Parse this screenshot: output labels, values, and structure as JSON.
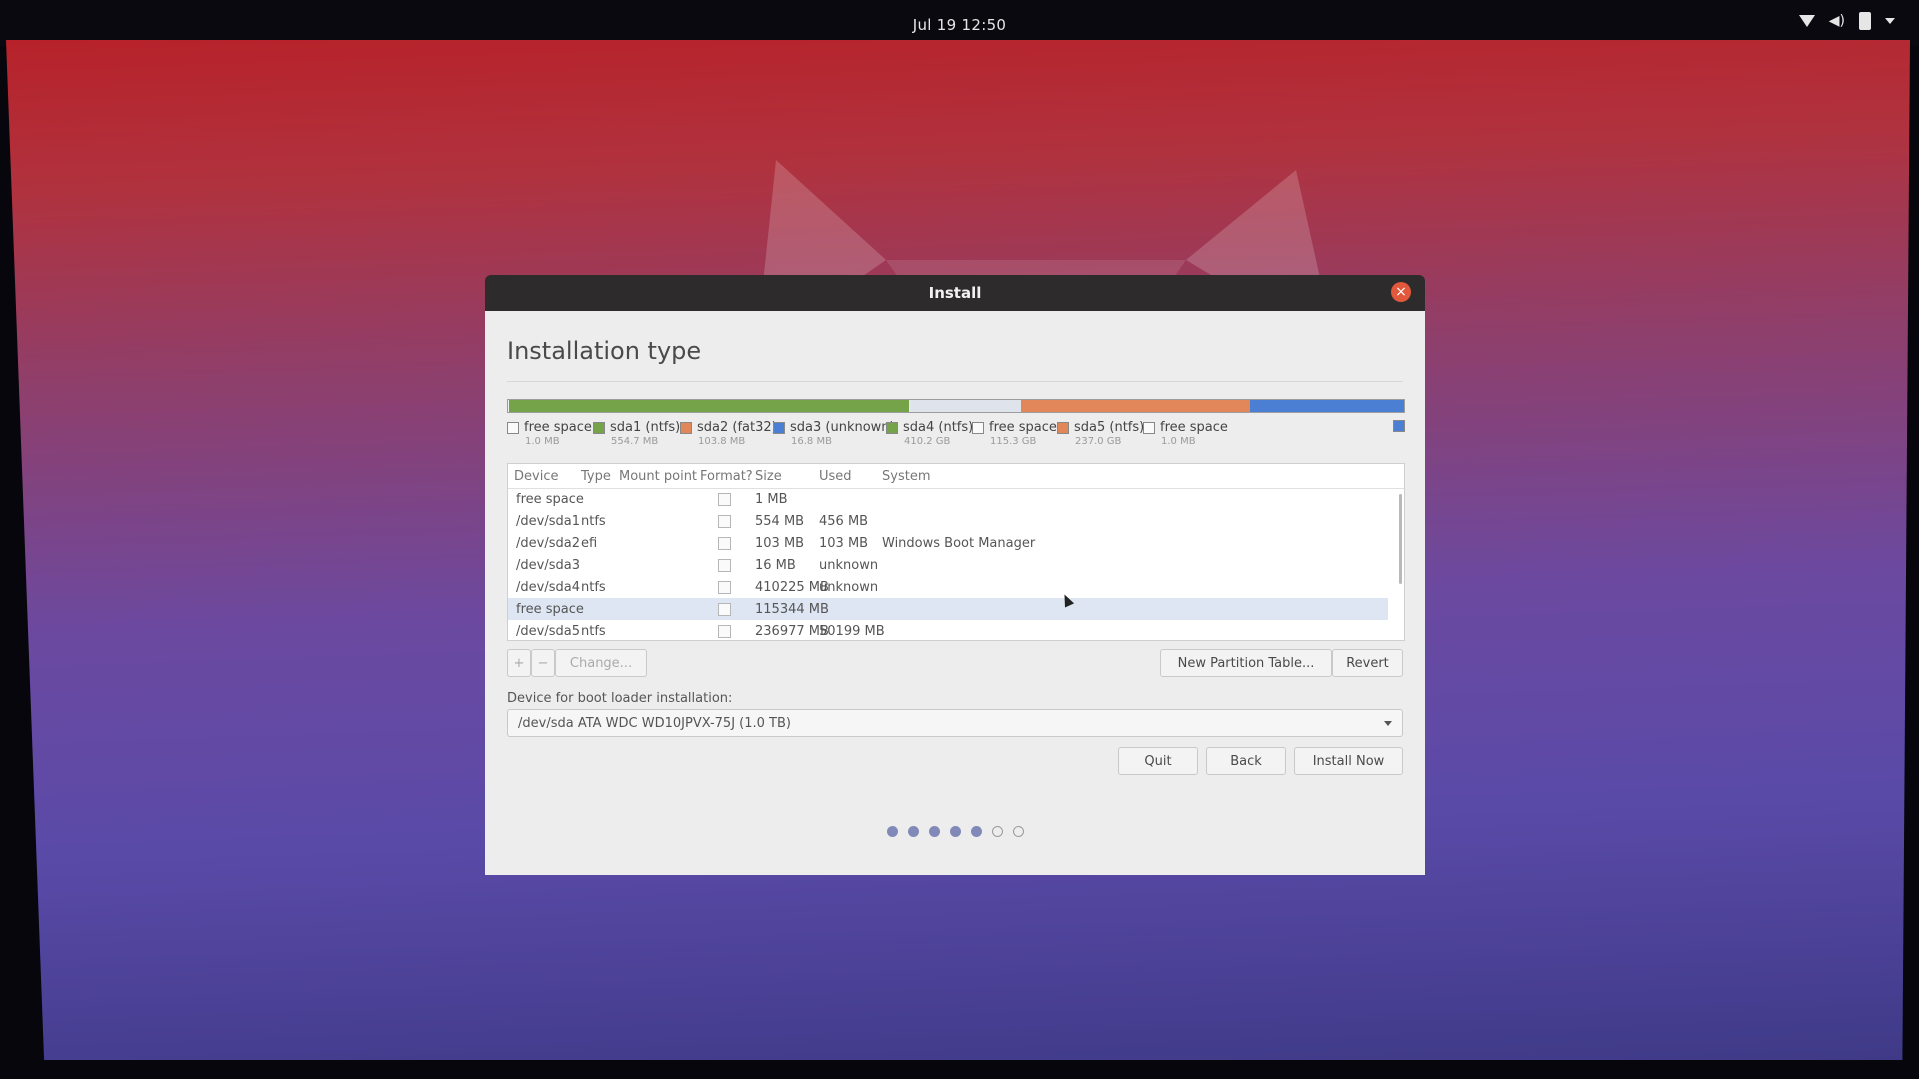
{
  "topbar": {
    "clock": "Jul 19  12:50",
    "icons": [
      "wifi-icon",
      "volume-icon",
      "battery-icon",
      "system-menu-caret-icon"
    ]
  },
  "dialog": {
    "title": "Install",
    "heading": "Installation type",
    "disk_bar": [
      {
        "name": "free space",
        "color": "#f0f0f0",
        "share": 0.001
      },
      {
        "name": "sda1 (ntfs)",
        "color": "#74a34a",
        "share": 0.447
      },
      {
        "name": "sda2 (fat32)",
        "color": "#e8e9ec",
        "share": 0.001
      },
      {
        "name": "sda3 (unknown)",
        "color": "#e4e6ee",
        "share": 0.001
      },
      {
        "name": "sda4 (ntfs)",
        "color": "#dfe3ec",
        "share": 0.123
      },
      {
        "name": "free space",
        "color": "#e2875a",
        "share": 0.255
      },
      {
        "name": "sda5 (ntfs)",
        "color": "#4a7fd3",
        "share": 0.172
      }
    ],
    "legend": [
      {
        "label": "free space",
        "size": "1.0 MB",
        "color": "#fafafa"
      },
      {
        "label": "sda1 (ntfs)",
        "size": "554.7 MB",
        "color": "#74a34a"
      },
      {
        "label": "sda2 (fat32)",
        "size": "103.8 MB",
        "color": "#e2875a"
      },
      {
        "label": "sda3 (unknown)",
        "size": "16.8 MB",
        "color": "#4a7fd3"
      },
      {
        "label": "sda4 (ntfs)",
        "size": "410.2 GB",
        "color": "#74a34a"
      },
      {
        "label": "free space",
        "size": "115.3 GB",
        "color": "#fafafa"
      },
      {
        "label": "sda5 (ntfs)",
        "size": "237.0 GB",
        "color": "#e2875a"
      },
      {
        "label": "free space",
        "size": "1.0 MB",
        "color": "#fafafa"
      }
    ],
    "table": {
      "headers": [
        "Device",
        "Type",
        "Mount point",
        "Format?",
        "Size",
        "Used",
        "System"
      ],
      "rows": [
        {
          "device": "free space",
          "type": "",
          "mount": "",
          "size": "1 MB",
          "used": "",
          "system": ""
        },
        {
          "device": "/dev/sda1",
          "type": "ntfs",
          "mount": "",
          "size": "554 MB",
          "used": "456 MB",
          "system": ""
        },
        {
          "device": "/dev/sda2",
          "type": "efi",
          "mount": "",
          "size": "103 MB",
          "used": "103 MB",
          "system": "Windows Boot Manager"
        },
        {
          "device": "/dev/sda3",
          "type": "",
          "mount": "",
          "size": "16 MB",
          "used": "unknown",
          "system": ""
        },
        {
          "device": "/dev/sda4",
          "type": "ntfs",
          "mount": "",
          "size": "410225 MB",
          "used": "unknown",
          "system": ""
        },
        {
          "device": "free space",
          "type": "",
          "mount": "",
          "size": "115344 MB",
          "used": "",
          "system": ""
        },
        {
          "device": "/dev/sda5",
          "type": "ntfs",
          "mount": "",
          "size": "236977 MB",
          "used": "50199 MB",
          "system": ""
        }
      ],
      "selected_row": 5
    },
    "buttons": {
      "add": "+",
      "remove": "−",
      "change": "Change...",
      "new_partition_table": "New Partition Table...",
      "revert": "Revert",
      "quit": "Quit",
      "back": "Back",
      "install_now": "Install Now"
    },
    "boot_loader": {
      "label": "Device for boot loader installation:",
      "value": "/dev/sda   ATA WDC WD10JPVX-75J (1.0 TB)"
    },
    "progress": {
      "completed_steps": 5,
      "total_steps": 7
    }
  }
}
